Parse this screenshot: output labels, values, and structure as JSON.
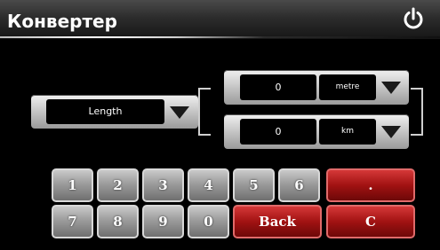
{
  "app": {
    "title": "Конвертер"
  },
  "icons": {
    "power": "power-icon",
    "dropdown": "triangle-down-icon"
  },
  "category": {
    "value": "Length"
  },
  "from": {
    "value": "0",
    "unit": "metre"
  },
  "to": {
    "value": "0",
    "unit": "km"
  },
  "keypad": {
    "row1": [
      "1",
      "2",
      "3",
      "4",
      "5",
      "6"
    ],
    "dot": ".",
    "row2": [
      "7",
      "8",
      "9",
      "0"
    ],
    "back": "Back",
    "clear": "C"
  },
  "colors": {
    "accent_red": "#a11212",
    "panel": "#c9c9c9",
    "background": "#000000"
  }
}
